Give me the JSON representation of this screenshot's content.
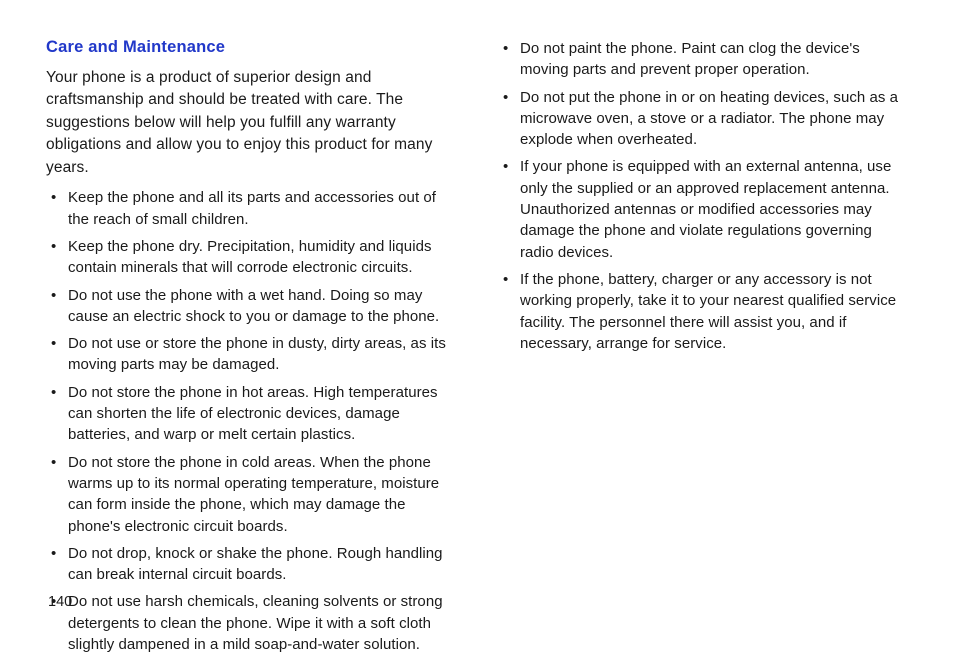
{
  "heading": "Care and Maintenance",
  "intro": "Your phone is a product of superior design and craftsmanship and should be treated with care. The suggestions below will help you fulfill any warranty obligations and allow you to enjoy this product for many years.",
  "col1_items": [
    "Keep the phone and all its parts and accessories out of the reach of small children.",
    "Keep the phone dry. Precipitation, humidity and liquids contain minerals that will corrode electronic circuits.",
    "Do not use the phone with a wet hand. Doing so may cause an electric shock to you or damage to the phone.",
    "Do not use or store the phone in dusty, dirty areas, as its moving parts may be damaged.",
    "Do not store the phone in hot areas. High temperatures can shorten the life of electronic devices, damage batteries, and warp or melt certain plastics.",
    "Do not store the phone in cold areas. When the phone warms up to its normal operating temperature, moisture can form inside the phone, which may damage the phone's electronic circuit boards.",
    "Do not drop, knock or shake the phone. Rough handling can break internal circuit boards.",
    "Do not use harsh chemicals, cleaning solvents or strong detergents to clean the phone. Wipe it with a soft cloth slightly dampened in a mild soap-and-water solution."
  ],
  "col2_items": [
    "Do not paint the phone. Paint can clog the device's moving parts and prevent proper operation.",
    "Do not put the phone in or on heating devices, such as a microwave oven, a stove or a radiator. The phone may explode when overheated.",
    "If your phone is equipped with an external antenna, use only the supplied or an approved replacement antenna. Unauthorized antennas or modified accessories may damage the phone and violate regulations governing radio devices.",
    "If the phone, battery, charger or any accessory is not working properly, take it to your nearest qualified service facility. The personnel there will assist you, and if necessary, arrange for service."
  ],
  "page_number": "140"
}
